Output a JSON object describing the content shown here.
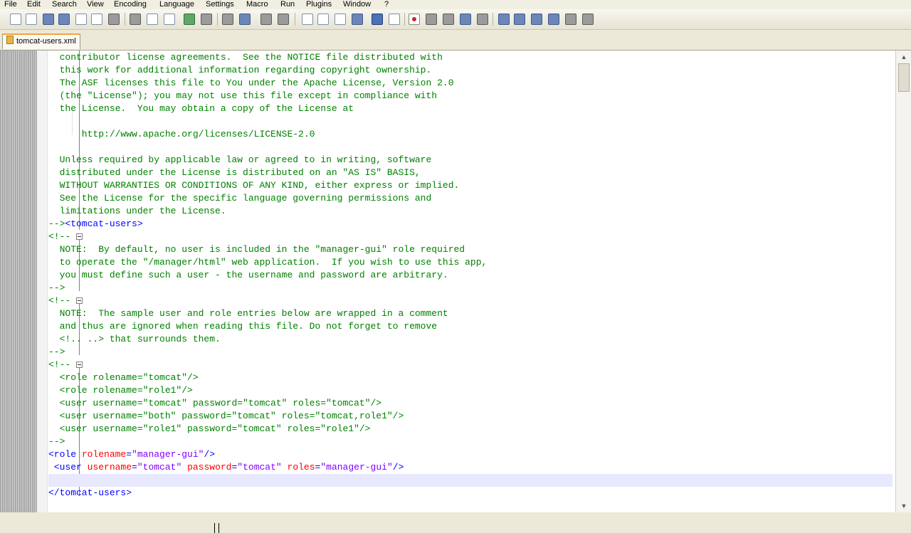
{
  "menu": [
    "File",
    "Edit",
    "Search",
    "View",
    "Encoding",
    "Language",
    "Settings",
    "Macro",
    "Run",
    "Plugins",
    "Window",
    "?"
  ],
  "tab": {
    "label": "tomcat-users.xml"
  },
  "editor": {
    "lines": [
      [
        {
          "t": "  contributor license agreements.  See the NOTICE file distributed with",
          "k": "c"
        }
      ],
      [
        {
          "t": "  this work for additional information regarding copyright ownership.",
          "k": "c"
        }
      ],
      [
        {
          "t": "  The ASF licenses this file to You under the Apache License, Version 2.0",
          "k": "c"
        }
      ],
      [
        {
          "t": "  (the \"License\"); you may not use this file except in compliance with",
          "k": "c"
        }
      ],
      [
        {
          "t": "  the License.  You may obtain a copy of the License at",
          "k": "c"
        }
      ],
      [
        {
          "t": "",
          "k": "c"
        }
      ],
      [
        {
          "t": "      http://www.apache.org/licenses/LICENSE-2.0",
          "k": "c"
        }
      ],
      [
        {
          "t": "",
          "k": "c"
        }
      ],
      [
        {
          "t": "  Unless required by applicable law or agreed to in writing, software",
          "k": "c"
        }
      ],
      [
        {
          "t": "  distributed under the License is distributed on an \"AS IS\" BASIS,",
          "k": "c"
        }
      ],
      [
        {
          "t": "  WITHOUT WARRANTIES OR CONDITIONS OF ANY KIND, either express or implied.",
          "k": "c"
        }
      ],
      [
        {
          "t": "  See the License for the specific language governing permissions and",
          "k": "c"
        }
      ],
      [
        {
          "t": "  limitations under the License.",
          "k": "c"
        }
      ],
      [
        {
          "t": "-->",
          "k": "c"
        },
        {
          "t": "<tomcat-users>",
          "k": "tag"
        }
      ],
      [
        {
          "t": "<!--",
          "k": "c"
        }
      ],
      [
        {
          "t": "  NOTE:  By default, no user is included in the \"manager-gui\" role required",
          "k": "c"
        }
      ],
      [
        {
          "t": "  to operate the \"/manager/html\" web application.  If you wish to use this app,",
          "k": "c"
        }
      ],
      [
        {
          "t": "  you must define such a user - the username and password are arbitrary.",
          "k": "c"
        }
      ],
      [
        {
          "t": "-->",
          "k": "c"
        }
      ],
      [
        {
          "t": "<!--",
          "k": "c"
        }
      ],
      [
        {
          "t": "  NOTE:  The sample user and role entries below are wrapped in a comment",
          "k": "c"
        }
      ],
      [
        {
          "t": "  and thus are ignored when reading this file. Do not forget to remove",
          "k": "c"
        }
      ],
      [
        {
          "t": "  <!.. ..> that surrounds them.",
          "k": "c"
        }
      ],
      [
        {
          "t": "-->",
          "k": "c"
        }
      ],
      [
        {
          "t": "<!--",
          "k": "c"
        }
      ],
      [
        {
          "t": "  <role rolename=\"tomcat\"/>",
          "k": "c"
        }
      ],
      [
        {
          "t": "  <role rolename=\"role1\"/>",
          "k": "c"
        }
      ],
      [
        {
          "t": "  <user username=\"tomcat\" password=\"tomcat\" roles=\"tomcat\"/>",
          "k": "c"
        }
      ],
      [
        {
          "t": "  <user username=\"both\" password=\"tomcat\" roles=\"tomcat,role1\"/>",
          "k": "c"
        }
      ],
      [
        {
          "t": "  <user username=\"role1\" password=\"tomcat\" roles=\"role1\"/>",
          "k": "c"
        }
      ],
      [
        {
          "t": "-->",
          "k": "c"
        }
      ],
      [
        {
          "t": "<role",
          "k": "tag"
        },
        {
          "t": " rolename",
          "k": "attr"
        },
        {
          "t": "=",
          "k": "punct"
        },
        {
          "t": "\"manager-gui\"",
          "k": "val"
        },
        {
          "t": "/>",
          "k": "tag"
        }
      ],
      [
        {
          "t": " <user",
          "k": "tag"
        },
        {
          "t": " username",
          "k": "attr"
        },
        {
          "t": "=",
          "k": "punct"
        },
        {
          "t": "\"tomcat\"",
          "k": "val"
        },
        {
          "t": " password",
          "k": "attr"
        },
        {
          "t": "=",
          "k": "punct"
        },
        {
          "t": "\"tomcat\"",
          "k": "val"
        },
        {
          "t": " roles",
          "k": "attr"
        },
        {
          "t": "=",
          "k": "punct"
        },
        {
          "t": "\"manager-gui\"",
          "k": "val"
        },
        {
          "t": "/>",
          "k": "tag"
        }
      ],
      [
        {
          "t": "",
          "k": "c"
        }
      ],
      [
        {
          "t": "</tomcat-users>",
          "k": "tag"
        }
      ]
    ],
    "current_line": 33
  }
}
